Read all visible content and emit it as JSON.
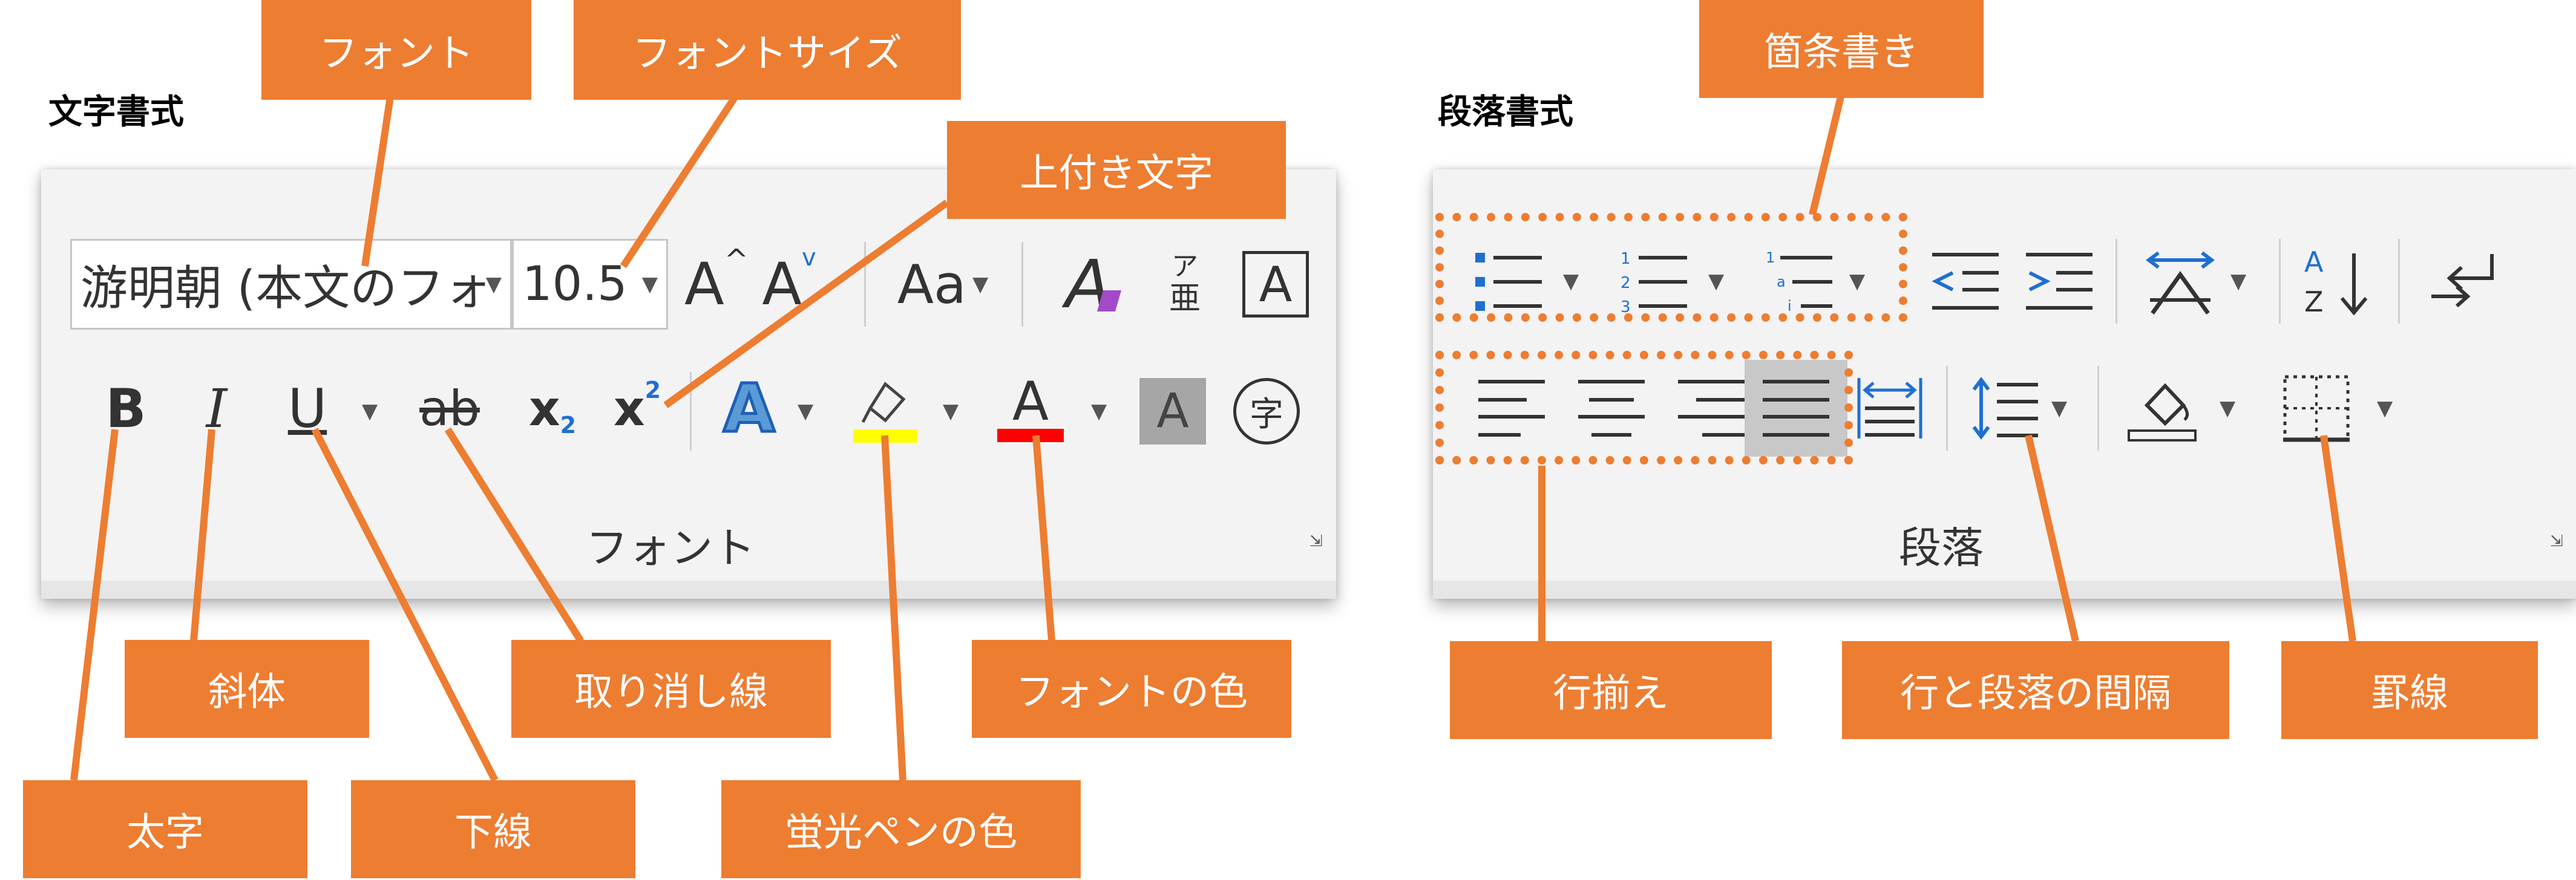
{
  "font_section": {
    "heading": "文字書式",
    "font_name": "游明朝 (本文のフォ",
    "font_size": "10.5",
    "case_button": "Aa",
    "group_label": "フォント",
    "bold": "B",
    "italic": "I",
    "underline": "U",
    "strike": "ab",
    "subscript_base": "x",
    "subscript_mark": "2",
    "superscript_base": "x",
    "superscript_mark": "2",
    "phonetic_top": "ア",
    "phonetic_bottom": "亜",
    "char_border": "A",
    "text_effect": "A",
    "font_color_letter": "A",
    "shading_letter": "A",
    "enclose_char": "字",
    "grow_font": "A",
    "shrink_font": "A",
    "clear_format": "A"
  },
  "paragraph_section": {
    "heading": "段落書式",
    "group_label": "段落"
  },
  "callouts": {
    "font": "フォント",
    "font_size": "フォントサイズ",
    "superscript": "上付き文字",
    "italic": "斜体",
    "strikethrough": "取り消し線",
    "font_color": "フォントの色",
    "bold": "太字",
    "underline": "下線",
    "highlight": "蛍光ペンの色",
    "bullets": "箇条書き",
    "align": "行揃え",
    "line_spacing": "行と段落の間隔",
    "borders": "罫線"
  },
  "colors": {
    "accent": "#ed7d31",
    "highlight_bar": "#ffff00",
    "font_color_bar": "#ff0000",
    "text_effect_blue": "#2e75d4",
    "clear_format_purple": "#a24ac9",
    "icon_blue": "#1f6fd1"
  },
  "icons": {
    "font_launcher": "dialog-launcher-icon",
    "paragraph_launcher": "dialog-launcher-icon"
  }
}
